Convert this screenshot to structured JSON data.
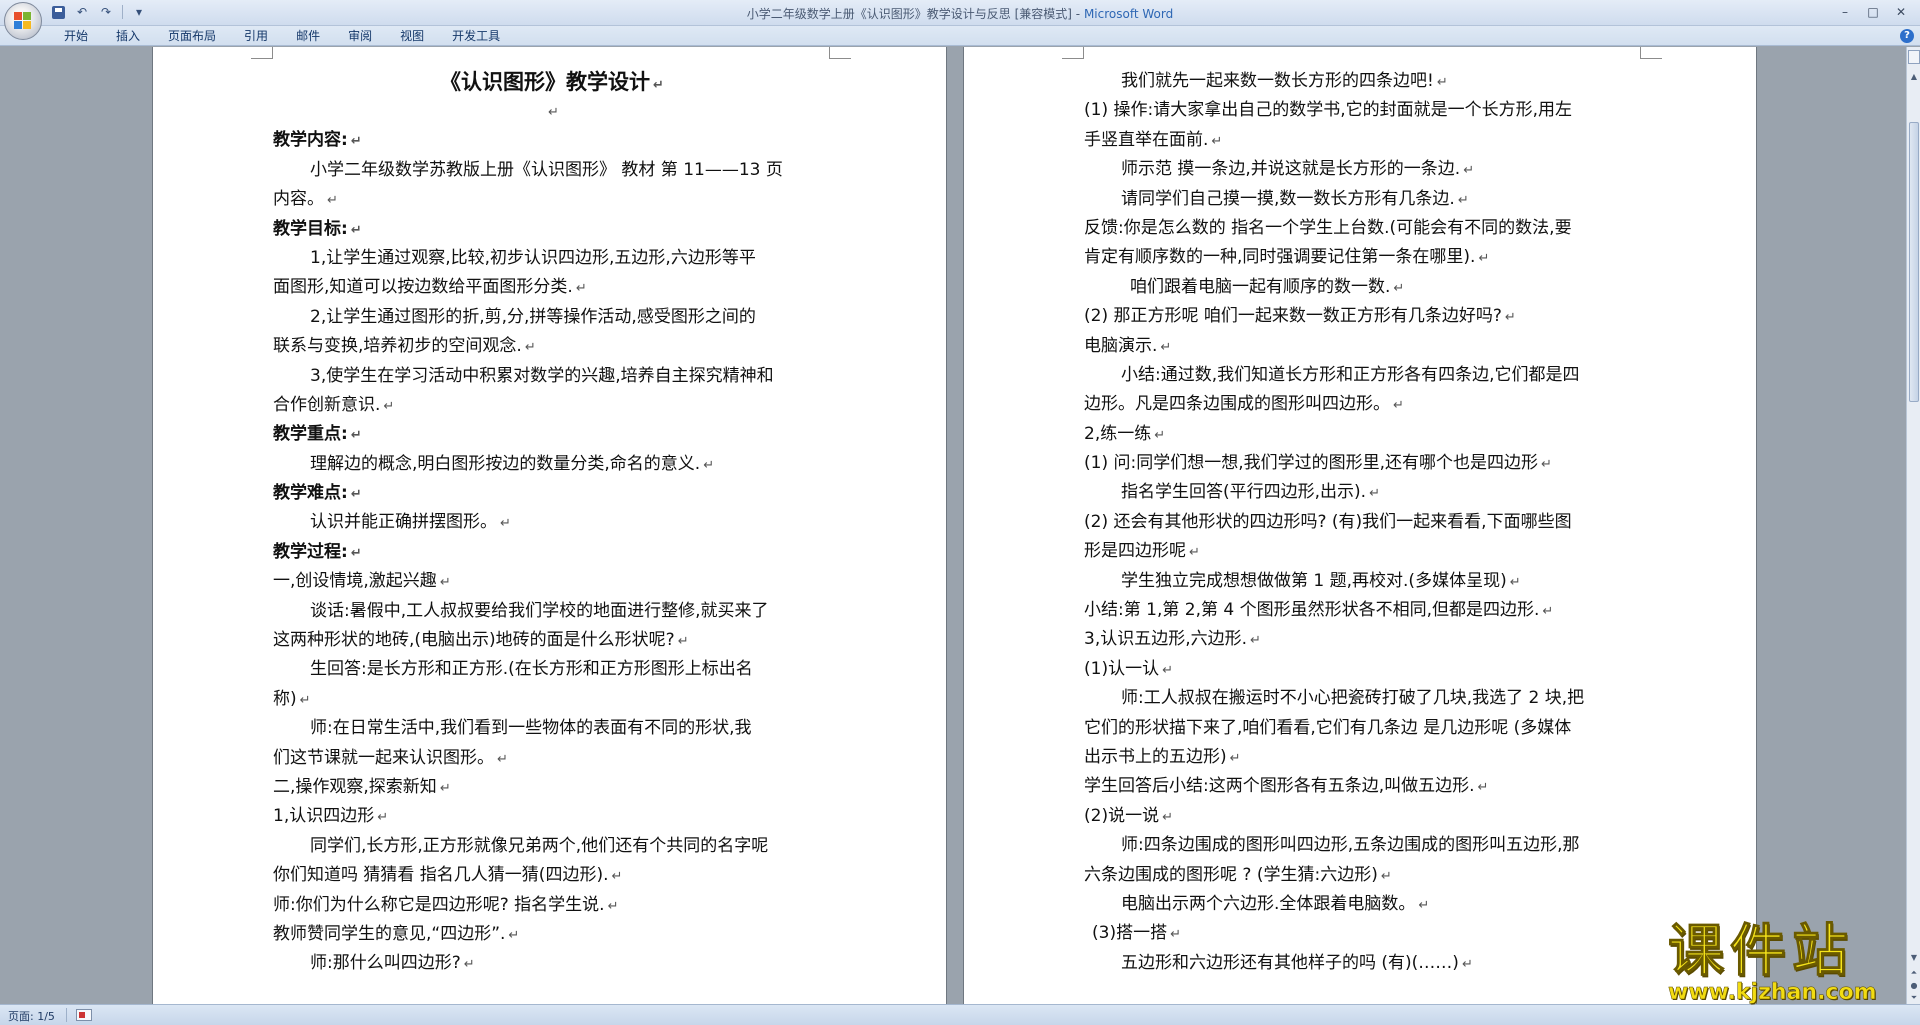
{
  "window": {
    "title_doc": "小学二年级数学上册《认识图形》教学设计与反思 [兼容模式] -",
    "title_app": "Microsoft Word"
  },
  "quick_access": [
    "save-icon",
    "undo-icon",
    "redo-icon",
    "customize-icon"
  ],
  "ribbon": {
    "tabs": [
      "开始",
      "插入",
      "页面布局",
      "引用",
      "邮件",
      "审阅",
      "视图",
      "开发工具"
    ]
  },
  "status": {
    "page": "页面: 1/5"
  },
  "watermark": {
    "top": "课件站",
    "url": "www.kjzhan.com"
  },
  "document": {
    "left_page": [
      "《认识图形》教学设计",
      "",
      "教学内容:",
      "小学二年级数学苏教版上册《认识图形》 教材   第 11——13 页",
      "内容。",
      "教学目标:",
      "1,让学生通过观察,比较,初步认识四边形,五边形,六边形等平",
      "面图形,知道可以按边数给平面图形分类.",
      "2,让学生通过图形的折,剪,分,拼等操作活动,感受图形之间的",
      "联系与变换,培养初步的空间观念.",
      "3,使学生在学习活动中积累对数学的兴趣,培养自主探究精神和",
      "合作创新意识.",
      "教学重点:",
      "理解边的概念,明白图形按边的数量分类,命名的意义.",
      "教学难点:",
      "认识并能正确拼摆图形。",
      "教学过程:",
      "一,创设情境,激起兴趣",
      "谈话:暑假中,工人叔叔要给我们学校的地面进行整修,就买来了",
      "这两种形状的地砖,(电脑出示)地砖的面是什么形状呢?",
      "生回答:是长方形和正方形.(在长方形和正方形图形上标出名",
      "称)",
      "师:在日常生活中,我们看到一些物体的表面有不同的形状,我",
      "们这节课就一起来认识图形。",
      "二,操作观察,探索新知",
      "1,认识四边形",
      "同学们,长方形,正方形就像兄弟两个,他们还有个共同的名字呢",
      "你们知道吗 猜猜看 指名几人猜一猜(四边形).",
      "师:你们为什么称它是四边形呢? 指名学生说.",
      "教师赞同学生的意见,“四边形”.",
      "师:那什么叫四边形?"
    ],
    "right_page": [
      "我们就先一起来数一数长方形的四条边吧!",
      "(1) 操作:请大家拿出自己的数学书,它的封面就是一个长方形,用左",
      "手竖直举在面前.",
      "师示范 摸一条边,并说这就是长方形的一条边.",
      "请同学们自己摸一摸,数一数长方形有几条边.",
      "反馈:你是怎么数的 指名一个学生上台数.(可能会有不同的数法,要",
      "肯定有顺序数的一种,同时强调要记住第一条在哪里).",
      "咱们跟着电脑一起有顺序的数一数.",
      "(2) 那正方形呢 咱们一起来数一数正方形有几条边好吗?",
      "电脑演示.",
      "小结:通过数,我们知道长方形和正方形各有四条边,它们都是四",
      "边形。凡是四条边围成的图形叫四边形。",
      "2,练一练",
      "(1) 问:同学们想一想,我们学过的图形里,还有哪个也是四边形",
      "指名学生回答(平行四边形,出示).",
      "(2) 还会有其他形状的四边形吗? (有)我们一起来看看,下面哪些图",
      "形是四边形呢",
      "学生独立完成想想做做第 1 题,再校对.(多媒体呈现)",
      "小结:第 1,第 2,第 4 个图形虽然形状各不相同,但都是四边形.",
      "3,认识五边形,六边形.",
      "(1)认一认",
      "师:工人叔叔在搬运时不小心把瓷砖打破了几块,我选了 2 块,把",
      "它们的形状描下来了,咱们看看,它们有几条边 是几边形呢 (多媒体",
      "出示书上的五边形)",
      "学生回答后小结:这两个图形各有五条边,叫做五边形.",
      "(2)说一说",
      "师:四条边围成的图形叫四边形,五条边围成的图形叫五边形,那",
      "六条边围成的图形呢 ? (学生猜:六边形)",
      "电脑出示两个六边形.全体跟着电脑数。",
      "(3)搭一搭",
      "五边形和六边形还有其他样子的吗 (有)(……)"
    ]
  }
}
